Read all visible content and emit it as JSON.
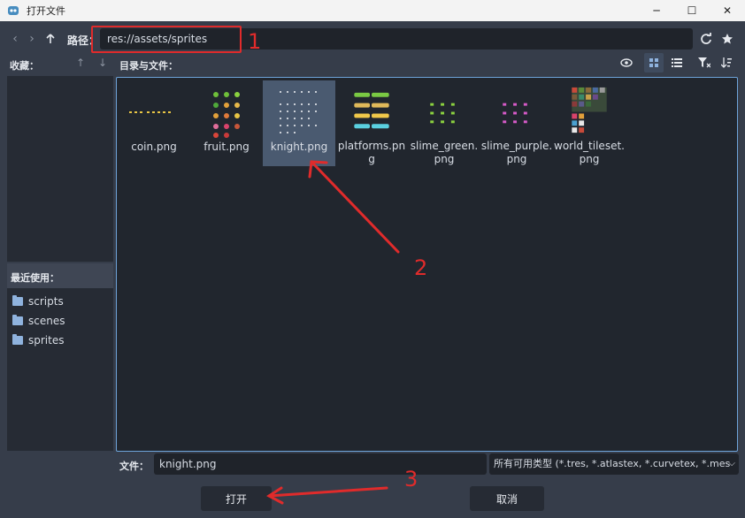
{
  "window": {
    "title": "打开文件",
    "controls": [
      "─",
      "☐",
      "✕"
    ]
  },
  "toolbar": {
    "path_label": "路径：",
    "path_value": "res://assets/sprites"
  },
  "favorites": {
    "label": "收藏："
  },
  "directory": {
    "label": "目录与文件："
  },
  "recent": {
    "label": "最近使用：",
    "items": [
      {
        "label": "scripts"
      },
      {
        "label": "scenes"
      },
      {
        "label": "sprites"
      }
    ]
  },
  "files": [
    {
      "name": "coin.png",
      "thumb": "coin"
    },
    {
      "name": "fruit.png",
      "thumb": "fruit"
    },
    {
      "name": "knight.png",
      "thumb": "knight",
      "selected": true
    },
    {
      "name": "platforms.png",
      "thumb": "platforms"
    },
    {
      "name": "slime_green.png",
      "thumb": "slime_green"
    },
    {
      "name": "slime_purple.png",
      "thumb": "slime_purple"
    },
    {
      "name": "world_tileset.png",
      "thumb": "world_tileset"
    }
  ],
  "footer": {
    "file_label": "文件：",
    "file_value": "knight.png",
    "filter_value": "所有可用类型 (*.tres, *.atlastex, *.curvetex, *.mes",
    "open_label": "打开",
    "cancel_label": "取消"
  },
  "annotations": {
    "one": "1",
    "two": "2",
    "three": "3"
  },
  "colors": {
    "accent": "#6ea3d9",
    "annotation": "#e02b2b",
    "selection": "#4a5a70"
  }
}
